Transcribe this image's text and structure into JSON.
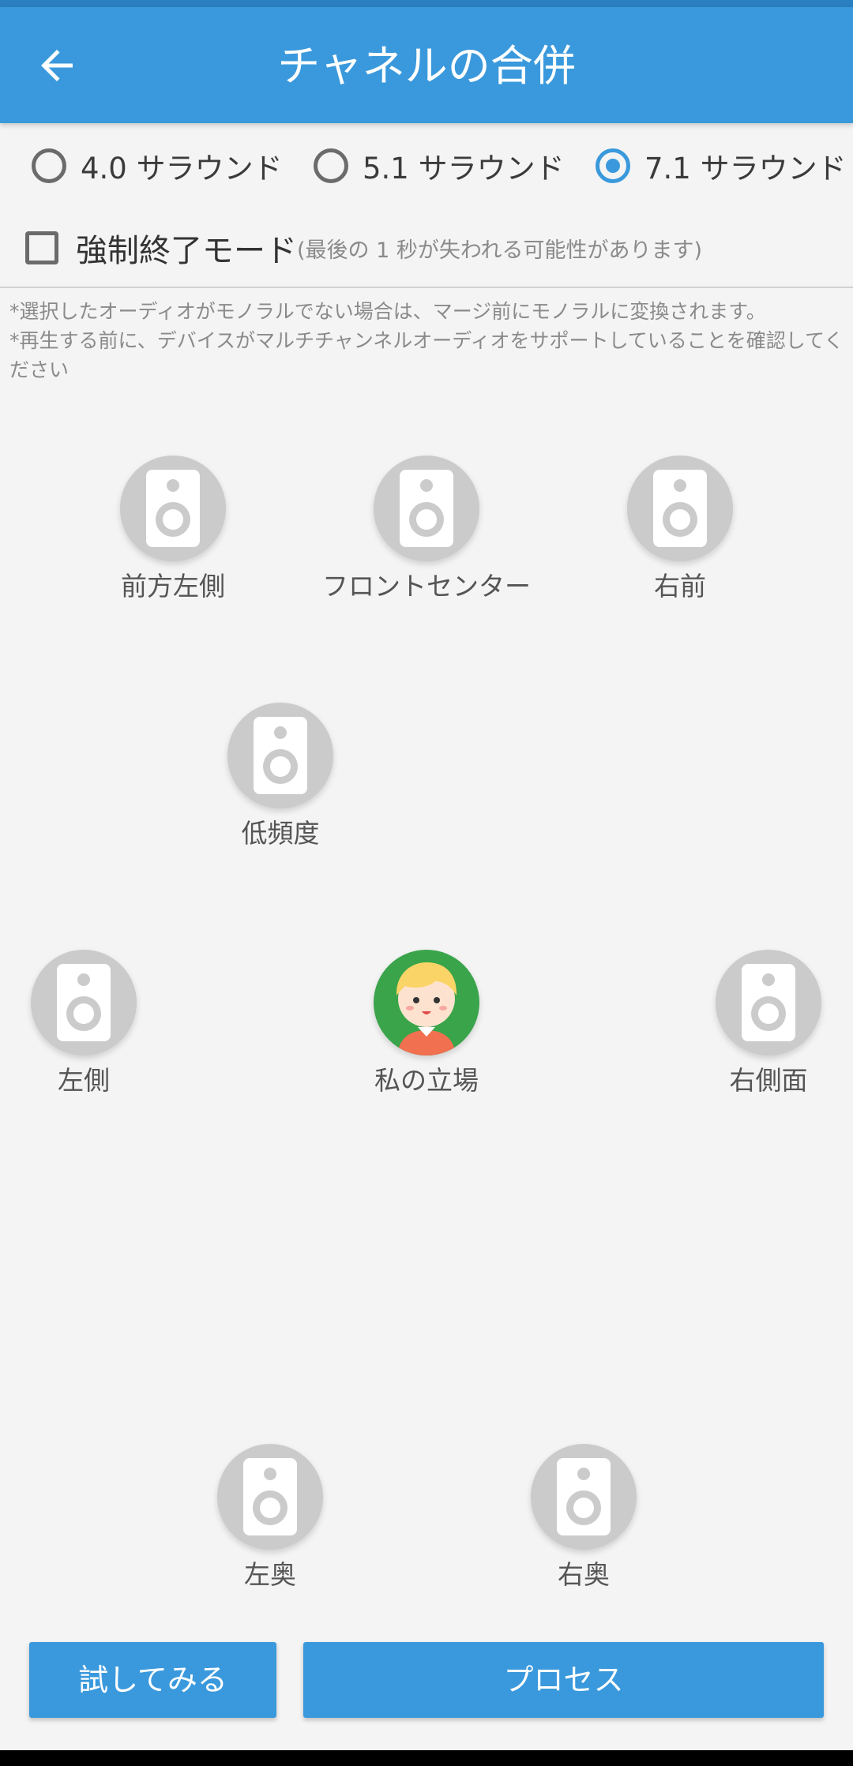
{
  "header": {
    "title": "チャネルの合併",
    "accent_color": "#3a99dc"
  },
  "modes": [
    {
      "label": "4.0 サラウンド",
      "selected": false
    },
    {
      "label": "5.1 サラウンド",
      "selected": false
    },
    {
      "label": "7.1 サラウンド",
      "selected": true
    }
  ],
  "force_quit": {
    "label": "強制終了モード",
    "hint": "(最後の 1 秒が失われる可能性があります)",
    "checked": false
  },
  "notes": [
    "*選択したオーディオがモノラルでない場合は、マージ前にモノラルに変換されます。",
    "*再生する前に、デバイスがマルチチャンネルオーディオをサポートしていることを確認してください"
  ],
  "speakers": {
    "front_left": "前方左側",
    "front_center": "フロントセンター",
    "front_right": "右前",
    "low_frequency": "低頻度",
    "side_left": "左側",
    "my_position": "私の立場",
    "side_right": "右側面",
    "back_left": "左奥",
    "back_right": "右奥"
  },
  "icons": {
    "speaker": "speaker-icon",
    "avatar": "avatar-icon",
    "back": "arrow-left-icon"
  },
  "actions": {
    "try": "試してみる",
    "process": "プロセス"
  }
}
